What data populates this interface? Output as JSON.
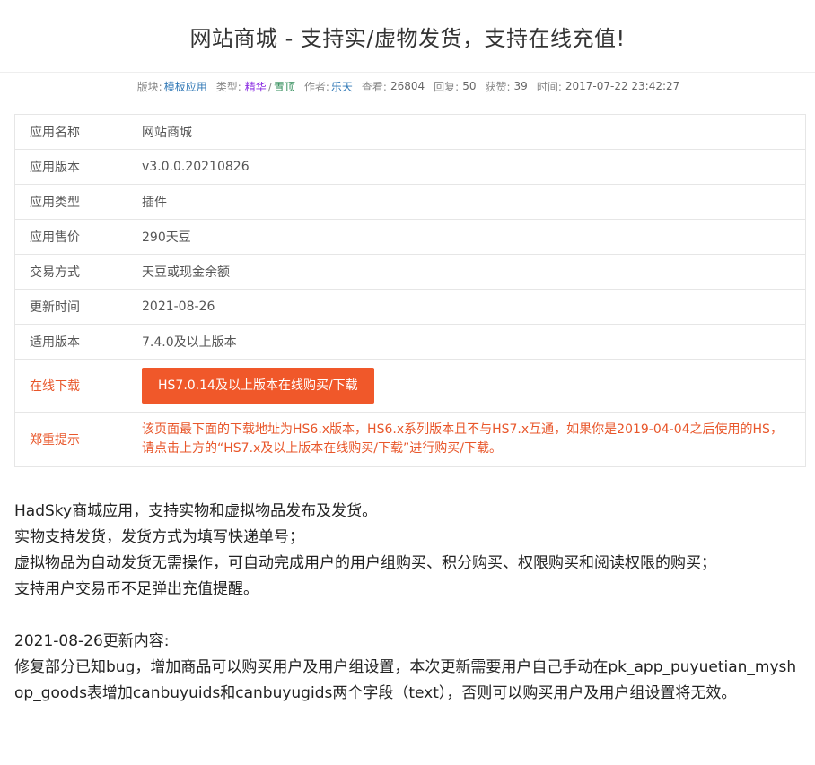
{
  "title": "网站商城 - 支持实/虚物发货，支持在线充值!",
  "meta": {
    "board_label": "版块:",
    "board_value": "模板应用",
    "type_label": "类型:",
    "type_value_1": "精华",
    "type_sep": "/",
    "type_value_2": "置顶",
    "author_label": "作者:",
    "author_value": "乐天",
    "views_label": "查看:",
    "views_value": "26804",
    "replies_label": "回复:",
    "replies_value": "50",
    "likes_label": "获赞:",
    "likes_value": "39",
    "time_label": "时间:",
    "time_value": "2017-07-22 23:42:27"
  },
  "info": {
    "name_label": "应用名称",
    "name_value": "网站商城",
    "version_label": "应用版本",
    "version_value": "v3.0.0.20210826",
    "type_label": "应用类型",
    "type_value": "插件",
    "price_label": "应用售价",
    "price_value": "290天豆",
    "trade_label": "交易方式",
    "trade_value": "天豆或现金余额",
    "updated_label": "更新时间",
    "updated_value": "2021-08-26",
    "compat_label": "适用版本",
    "compat_value": "7.4.0及以上版本",
    "download_label": "在线下载",
    "download_button": "HS7.0.14及以上版本在线购买/下载",
    "notice_label": "郑重提示",
    "notice_text": "该页面最下面的下载地址为HS6.x版本，HS6.x系列版本且不与HS7.x互通，如果你是2019-04-04之后使用的HS，请点击上方的“HS7.x及以上版本在线购买/下载”进行购买/下载。"
  },
  "description": {
    "line1": "HadSky商城应用，支持实物和虚拟物品发布及发货。",
    "line2": "实物支持发货，发货方式为填写快递单号；",
    "line3": "虚拟物品为自动发货无需操作，可自动完成用户的用户组购买、积分购买、权限购买和阅读权限的购买；",
    "line4": "支持用户交易币不足弹出充值提醒。",
    "update_heading": "2021-08-26更新内容:",
    "update_text": "修复部分已知bug，增加商品可以购买用户及用户组设置，本次更新需要用户自己手动在pk_app_puyuetian_myshop_goods表增加canbuyuids和canbuyugids两个字段（text），否则可以购买用户及用户组设置将无效。"
  },
  "colors": {
    "accent": "#f0582a",
    "warning_text": "#e8562a",
    "link": "#337ab7"
  }
}
